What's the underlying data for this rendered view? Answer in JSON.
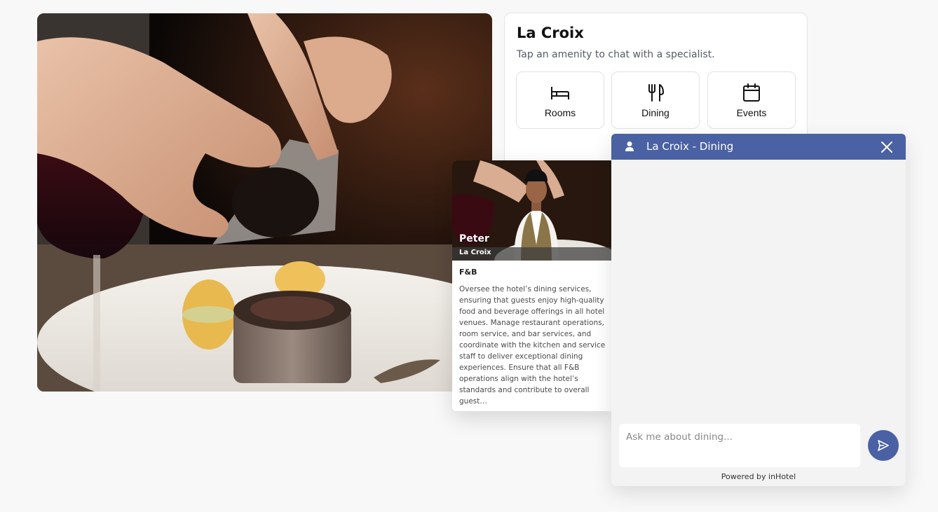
{
  "hero": {
    "image": "plated-dessert-truffle-photo"
  },
  "panel": {
    "title": "La Croix",
    "subtitle": "Tap an amenity to chat with a specialist.",
    "amenities": [
      {
        "label": "Rooms",
        "icon": "bed-icon"
      },
      {
        "label": "Dining",
        "icon": "fork-knife-icon"
      },
      {
        "label": "Events",
        "icon": "calendar-icon"
      }
    ]
  },
  "specialist": {
    "name": "Peter",
    "hotel": "La Croix",
    "role": "F&B",
    "description": "Oversee the hotel’s dining services, ensuring that guests enjoy high-quality food and beverage offerings in all hotel venues. Manage restaurant operations, room service, and bar services, and coordinate with the kitchen and service staff to deliver exceptional dining experiences. Ensure that all F&B operations align with the hotel’s standards and contribute to overall guest…"
  },
  "chat": {
    "title": "La Croix - Dining",
    "input_placeholder": "Ask me about dining...",
    "footer": "Powered by inHotel",
    "icons": {
      "user": "user-icon",
      "close": "close-icon",
      "send": "send-icon"
    },
    "accent_color": "#4a62a3"
  }
}
